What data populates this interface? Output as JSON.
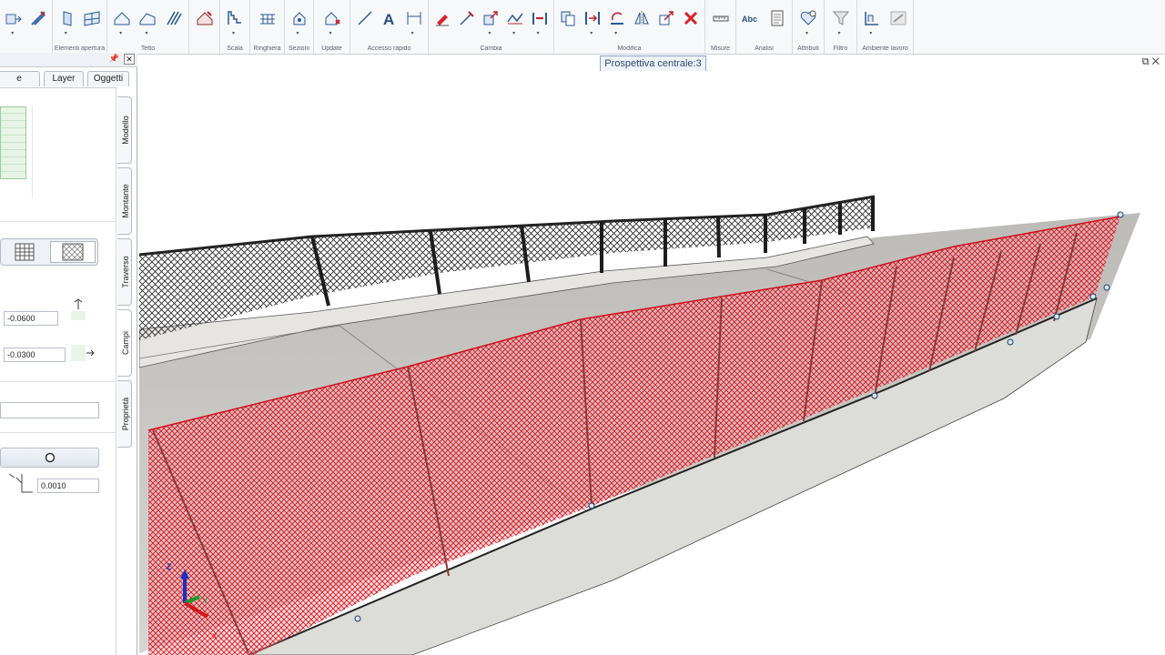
{
  "ribbon": {
    "groups": [
      {
        "label": "",
        "icons": [
          "wall-icon",
          "wall-edit-icon"
        ]
      },
      {
        "label": "Elementi apertura",
        "icons": [
          "door-icon",
          "window-icon"
        ]
      },
      {
        "label": "Tetto",
        "icons": [
          "roof-icon",
          "roof-edit-icon",
          "rafters-icon"
        ]
      },
      {
        "label": "",
        "icons": [
          "roof-cover-icon"
        ]
      },
      {
        "label": "Scala",
        "icons": [
          "stair-icon"
        ]
      },
      {
        "label": "Ringhiera",
        "icons": [
          "railing-icon"
        ]
      },
      {
        "label": "Sezioni",
        "icons": [
          "section-icon"
        ]
      },
      {
        "label": "Update",
        "icons": [
          "update-icon"
        ]
      },
      {
        "label": "Accesso rapido",
        "icons": [
          "line-icon",
          "text-icon",
          "dimension-icon"
        ]
      },
      {
        "label": "Cambia",
        "icons": [
          "eraser-icon",
          "split-icon",
          "stretch-icon",
          "polyline-icon",
          "join-icon"
        ]
      },
      {
        "label": "Modifica",
        "icons": [
          "copy-icon",
          "move-icon",
          "rotate-icon",
          "mirror-icon",
          "scale-icon",
          "delete-icon"
        ]
      },
      {
        "label": "Misure",
        "icons": [
          "measure-icon"
        ]
      },
      {
        "label": "Analisi",
        "icons": [
          "text-abc-icon",
          "report-icon"
        ]
      },
      {
        "label": "Attributi",
        "icons": [
          "attributes-icon"
        ]
      },
      {
        "label": "Filtro",
        "icons": [
          "filter-icon"
        ]
      },
      {
        "label": "Ambiente lavoro",
        "icons": [
          "workspace-icon",
          "workspace-settings-icon"
        ]
      }
    ]
  },
  "tooltip": "Prospettiva centrale:3",
  "panel": {
    "tabs": [
      "e Manager",
      "Layer",
      "Oggetti"
    ],
    "vertical_tabs": [
      "Modello",
      "Montante",
      "Traverso",
      "Campi",
      "Proprietà"
    ],
    "fields": {
      "offset_1": "-0.0600",
      "offset_2": "-0.0300",
      "empty_field": "",
      "thickness": "0.0010"
    }
  },
  "viewport": {
    "axes": {
      "z": "Z",
      "y": "Y",
      "x": "X"
    },
    "colors": {
      "selected_fence": "#e8101a",
      "fence_dark": "#2b2b2b",
      "concrete": "#d9d9d6",
      "pavement": "#c8c6c2"
    }
  }
}
